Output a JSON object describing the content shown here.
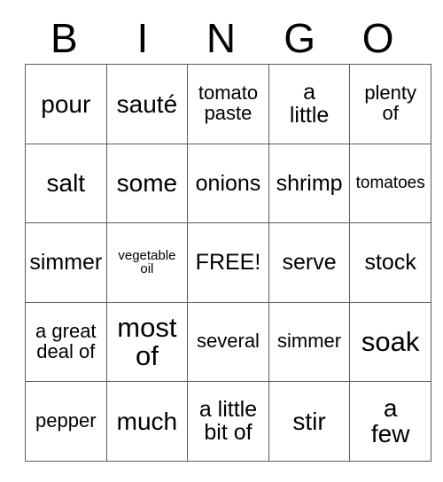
{
  "card": {
    "headers": [
      "B",
      "I",
      "N",
      "G",
      "O"
    ],
    "rows": [
      [
        {
          "text": "pour",
          "size": "lg"
        },
        {
          "text": "sauté",
          "size": "lg"
        },
        {
          "text": "tomato\npaste",
          "size": "sm"
        },
        {
          "text": "a\nlittle",
          "size": "md"
        },
        {
          "text": "plenty\nof",
          "size": "sm"
        }
      ],
      [
        {
          "text": "salt",
          "size": "lg"
        },
        {
          "text": "some",
          "size": "lg"
        },
        {
          "text": "onions",
          "size": "md"
        },
        {
          "text": "shrimp",
          "size": "md"
        },
        {
          "text": "tomatoes",
          "size": "xs"
        }
      ],
      [
        {
          "text": "simmer",
          "size": "md"
        },
        {
          "text": "vegetable\noil",
          "size": "xxs"
        },
        {
          "text": "FREE!",
          "size": "md"
        },
        {
          "text": "serve",
          "size": "md"
        },
        {
          "text": "stock",
          "size": "md"
        }
      ],
      [
        {
          "text": "a great\ndeal of",
          "size": "sm"
        },
        {
          "text": "most\nof",
          "size": "xl"
        },
        {
          "text": "several",
          "size": "sm"
        },
        {
          "text": "simmer",
          "size": "sm"
        },
        {
          "text": "soak",
          "size": "xl"
        }
      ],
      [
        {
          "text": "pepper",
          "size": "sm"
        },
        {
          "text": "much",
          "size": "lg"
        },
        {
          "text": "a little\nbit of",
          "size": "md"
        },
        {
          "text": "stir",
          "size": "lg"
        },
        {
          "text": "a\nfew",
          "size": "lg"
        }
      ]
    ],
    "free_space": "FREE!",
    "colors": {
      "background": "#ffffff",
      "text": "#000000",
      "grid_line": "#5a5a5a"
    }
  }
}
